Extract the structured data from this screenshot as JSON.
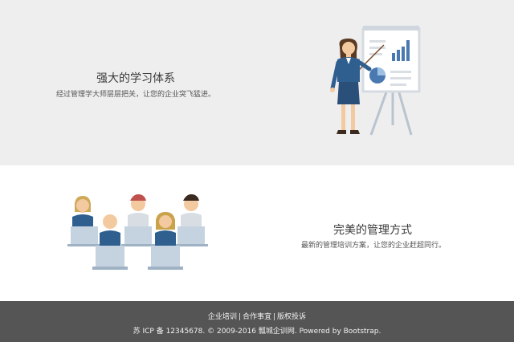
{
  "section_1": {
    "title": "强大的学习体系",
    "description": "经过管理学大师层层把关，让您的企业突飞猛进。"
  },
  "section_2": {
    "title": "完美的管理方式",
    "description": "最新的管理培训方案，让您的企业赶超同行。"
  },
  "footer": {
    "links": [
      "企业培训",
      "合作事宜",
      "版权投诉"
    ],
    "copyright": "苏 ICP 备 12345678. © 2009-2016 瓢城企训网. Powered by Bootstrap."
  },
  "colors": {
    "section_1_bg": "#eeeeee",
    "footer_bg": "#555555",
    "figure_blue": "#2f5f8f",
    "chart_blue": "#4a78b0"
  }
}
